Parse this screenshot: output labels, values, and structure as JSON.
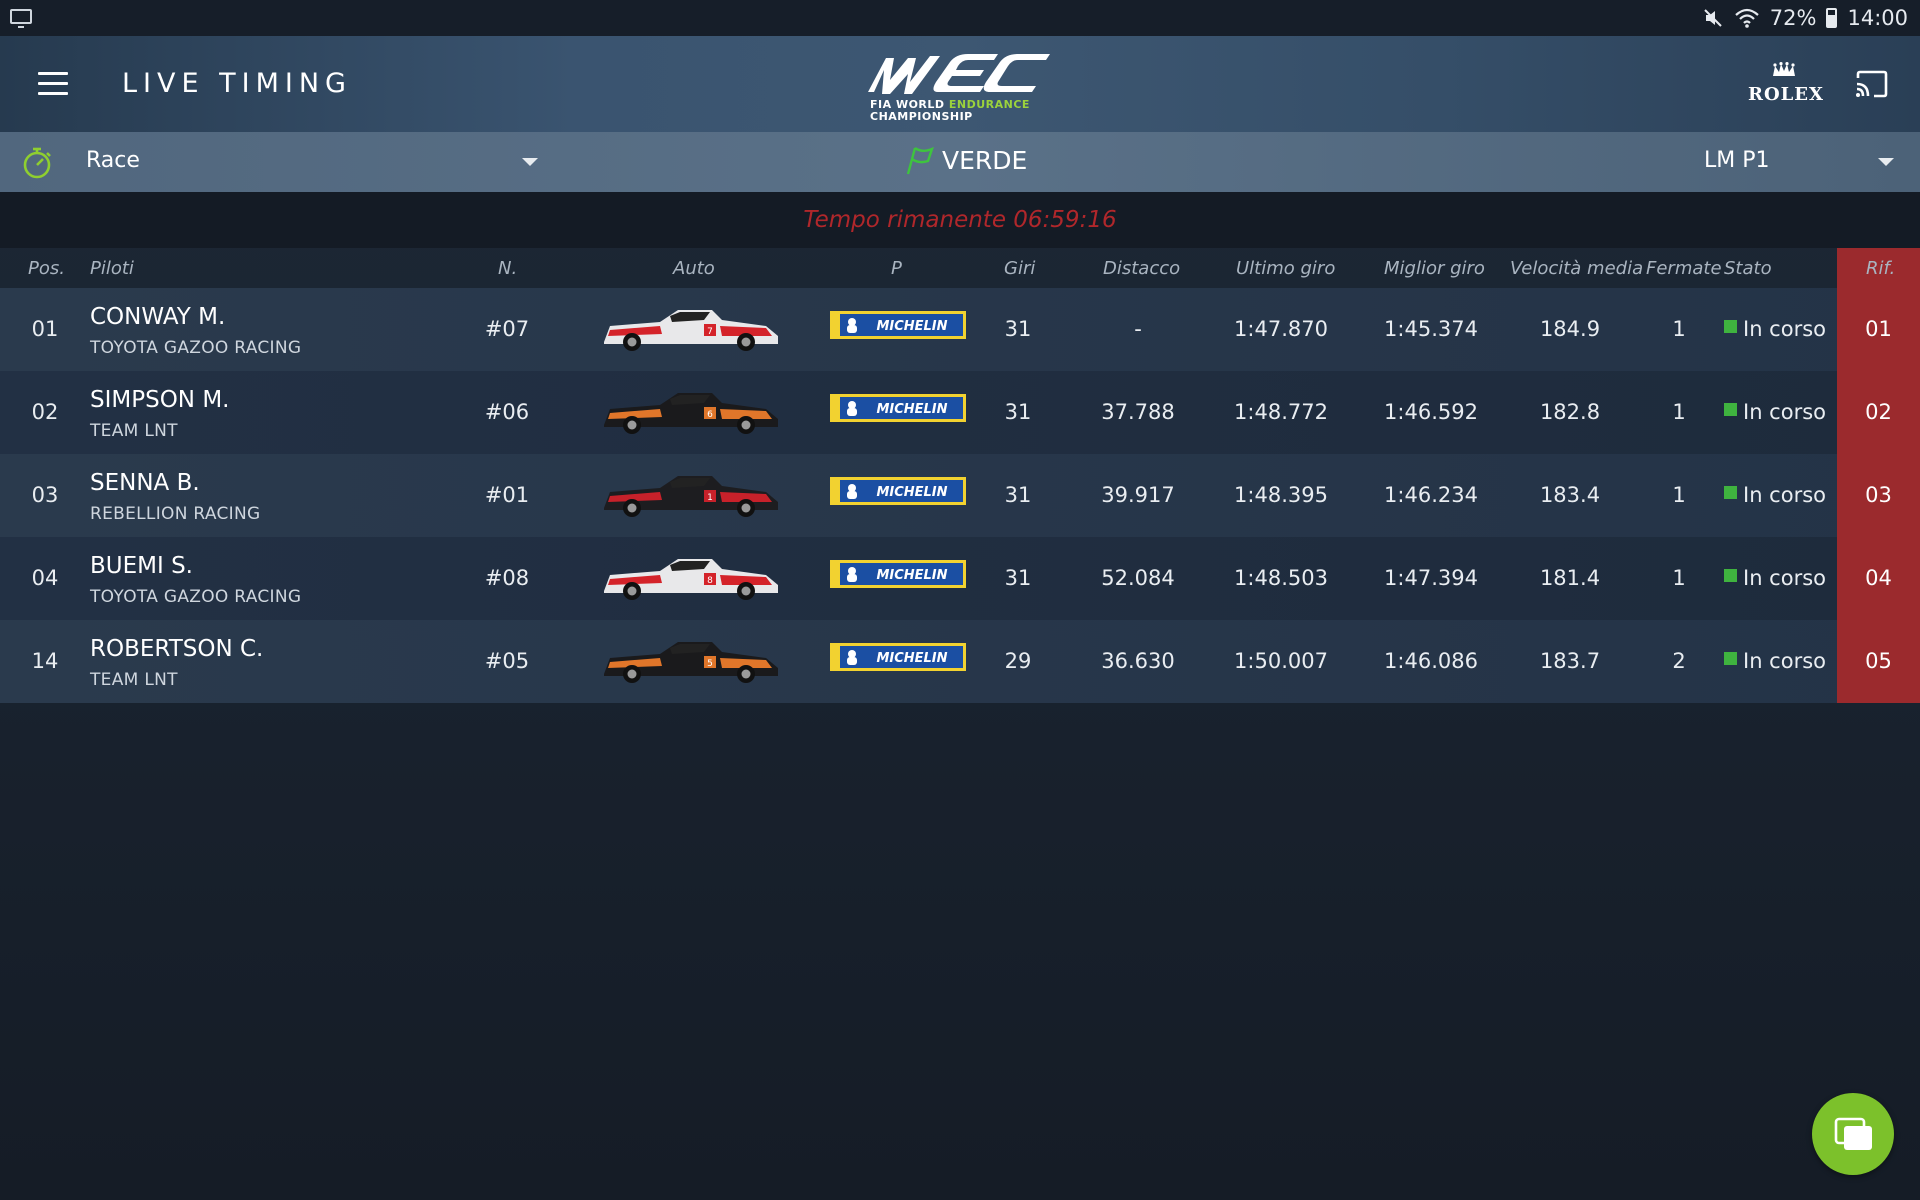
{
  "status_bar": {
    "battery": "72%",
    "time": "14:00"
  },
  "header": {
    "title": "LIVE TIMING",
    "logo_line1_a": "FIA WORLD ",
    "logo_line1_b": "ENDURANCE",
    "logo_line2": "CHAMPIONSHIP",
    "sponsor": "ROLEX"
  },
  "filters": {
    "session": "Race",
    "flag": "VERDE",
    "class": "LM P1"
  },
  "time_remaining": "Tempo rimanente 06:59:16",
  "columns": {
    "pos": "Pos.",
    "drivers": "Piloti",
    "number": "N.",
    "car": "Auto",
    "tyre": "P",
    "laps": "Giri",
    "gap": "Distacco",
    "last_lap": "Ultimo giro",
    "best_lap": "Miglior giro",
    "avg_speed": "Velocità media",
    "stops": "Fermate",
    "status": "Stato",
    "ref": "Rif."
  },
  "rows": [
    {
      "pos": "01",
      "driver": "CONWAY M.",
      "team": "TOYOTA GAZOO RACING",
      "number": "#07",
      "tyre": "MICHELIN",
      "laps": "31",
      "gap": "-",
      "last": "1:47.870",
      "best": "1:45.374",
      "speed": "184.9",
      "stops": "1",
      "status": "In corso",
      "ref": "01"
    },
    {
      "pos": "02",
      "driver": "SIMPSON M.",
      "team": "TEAM LNT",
      "number": "#06",
      "tyre": "MICHELIN",
      "laps": "31",
      "gap": "37.788",
      "last": "1:48.772",
      "best": "1:46.592",
      "speed": "182.8",
      "stops": "1",
      "status": "In corso",
      "ref": "02"
    },
    {
      "pos": "03",
      "driver": "SENNA B.",
      "team": "REBELLION RACING",
      "number": "#01",
      "tyre": "MICHELIN",
      "laps": "31",
      "gap": "39.917",
      "last": "1:48.395",
      "best": "1:46.234",
      "speed": "183.4",
      "stops": "1",
      "status": "In corso",
      "ref": "03"
    },
    {
      "pos": "04",
      "driver": "BUEMI S.",
      "team": "TOYOTA GAZOO RACING",
      "number": "#08",
      "tyre": "MICHELIN",
      "laps": "31",
      "gap": "52.084",
      "last": "1:48.503",
      "best": "1:47.394",
      "speed": "181.4",
      "stops": "1",
      "status": "In corso",
      "ref": "04"
    },
    {
      "pos": "14",
      "driver": "ROBERTSON C.",
      "team": "TEAM LNT",
      "number": "#05",
      "tyre": "MICHELIN",
      "laps": "29",
      "gap": "36.630",
      "last": "1:50.007",
      "best": "1:46.086",
      "speed": "183.7",
      "stops": "2",
      "status": "In corso",
      "ref": "05"
    }
  ],
  "colors": {
    "accent_green": "#7cc12b",
    "ref_red": "#9b2a2d",
    "time_red": "#b0272b",
    "status_green": "#3fb33f"
  },
  "icons": {
    "menu": "hamburger-menu-icon",
    "cast": "cast-icon",
    "stopwatch": "stopwatch-icon",
    "flag": "green-flag-icon",
    "fab": "multi-window-icon"
  }
}
